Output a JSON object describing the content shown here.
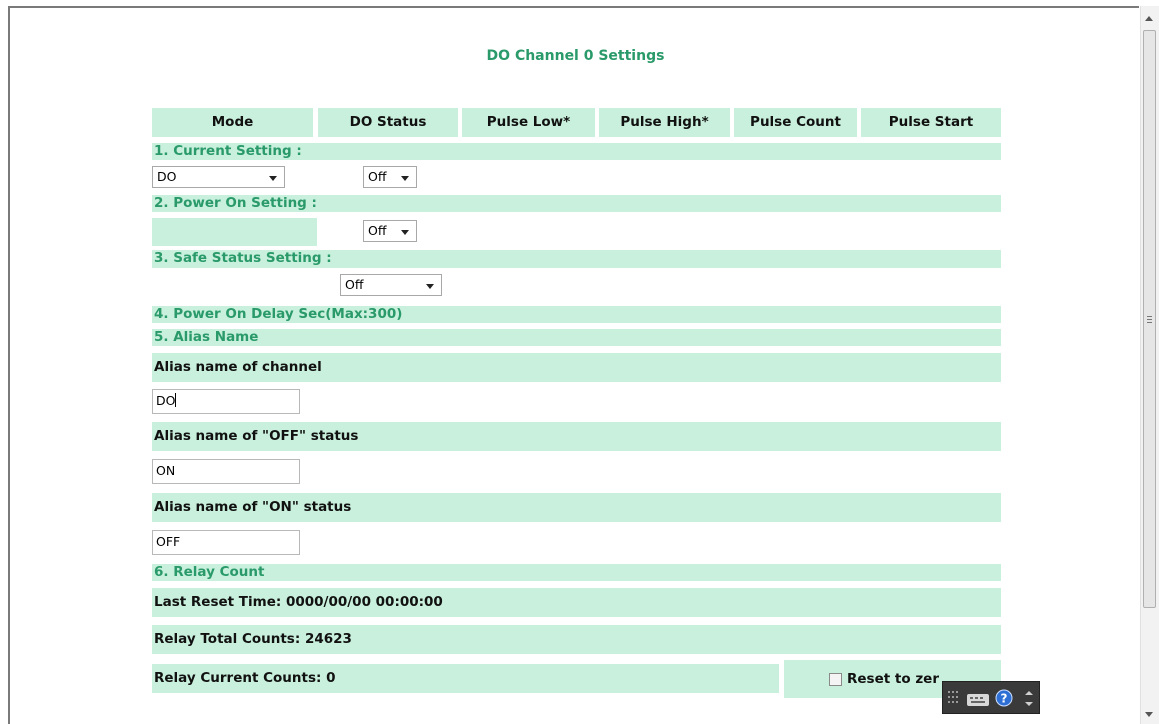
{
  "title": "DO Channel 0 Settings",
  "table_headers": [
    "Mode",
    "DO Status",
    "Pulse Low*",
    "Pulse High*",
    "Pulse Count",
    "Pulse Start"
  ],
  "sections": {
    "current": "1. Current Setting :",
    "power_on": "2. Power On Setting :",
    "safe": "3. Safe Status Setting :",
    "delay": "4. Power On Delay  Sec(Max:300)",
    "alias": "5. Alias Name",
    "relay": "6. Relay Count"
  },
  "current_setting": {
    "mode": "DO",
    "status": "Off"
  },
  "power_on_setting": {
    "status": "Off"
  },
  "safe_status_setting": {
    "status": "Off"
  },
  "alias": {
    "channel_label": "Alias name of  channel",
    "channel_value": "DO",
    "off_label": "Alias name of \"OFF\" status",
    "off_value": "ON",
    "on_label": "Alias name of \"ON\" status",
    "on_value": "OFF"
  },
  "relay": {
    "last_reset": "Last Reset Time: 0000/00/00 00:00:00",
    "total": "Relay Total Counts: 24623",
    "current": "Relay Current Counts: 0",
    "reset_label": "Reset to zer"
  },
  "colors": {
    "row_bg": "#c8f0dc",
    "section_text": "#2a9a6a"
  }
}
